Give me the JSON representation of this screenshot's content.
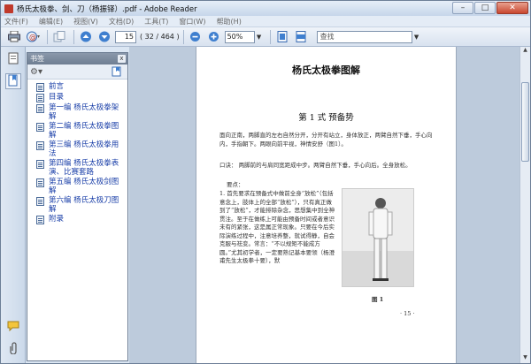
{
  "window": {
    "title": "杨氏太极拳、剑、刀（杨振铎）.pdf - Adobe Reader",
    "min": "–",
    "max": "□",
    "close": "✕"
  },
  "menu": [
    "文件(F)",
    "编辑(E)",
    "视图(V)",
    "文档(D)",
    "工具(T)",
    "窗口(W)",
    "帮助(H)"
  ],
  "toolbar": {
    "page_value": "15",
    "page_count": "( 32 / 464 )",
    "zoom": "50%",
    "search_placeholder": "查找"
  },
  "panel": {
    "title": "书签",
    "close": "x",
    "bookmarks": [
      "前言",
      "目录",
      "第一编 杨氏太极拳架解",
      "第二编 杨氏太极拳图解",
      "第三编 杨氏太极拳用法",
      "第四编 杨氏太极拳表演、比赛套路",
      "第五编 杨氏太极剑图解",
      "第六编 杨氏太极刀图解",
      "附录"
    ]
  },
  "page": {
    "heading": "杨氏太极拳图解",
    "section": "第 1 式    预备势",
    "intro": "面向正南，两脚直的左右自然分开，分开有站立，身体放正，两臂自然下垂，手心向内，手指朝下。两眼向前平视，神情安舒（图1）。",
    "tip": "口诀：  两脚前的与肩同宽距成中步。两臂自然下垂，手心向后。全身放松。",
    "point_label": "要点：",
    "body": "1. 首先要求在预备式中做前全身“放松”（包括意念上，肢体上的全部“放松”），只有真正做到了“放松”，才能排除杂念，思想集中到全神贯注。至于在做练上可能由预备时间或者意识未有的紧张，这是属正常现象。只要在今后实际演练过程中，注意培养整，就试得静，自会克服与祛变。常言：“不以规矩不能成方圆。”尤其初学者，一定要熟记基本要领（杨澄甫先生太极拳十要），默",
    "figure_caption": "图 1",
    "page_no": "· 15 ·"
  }
}
